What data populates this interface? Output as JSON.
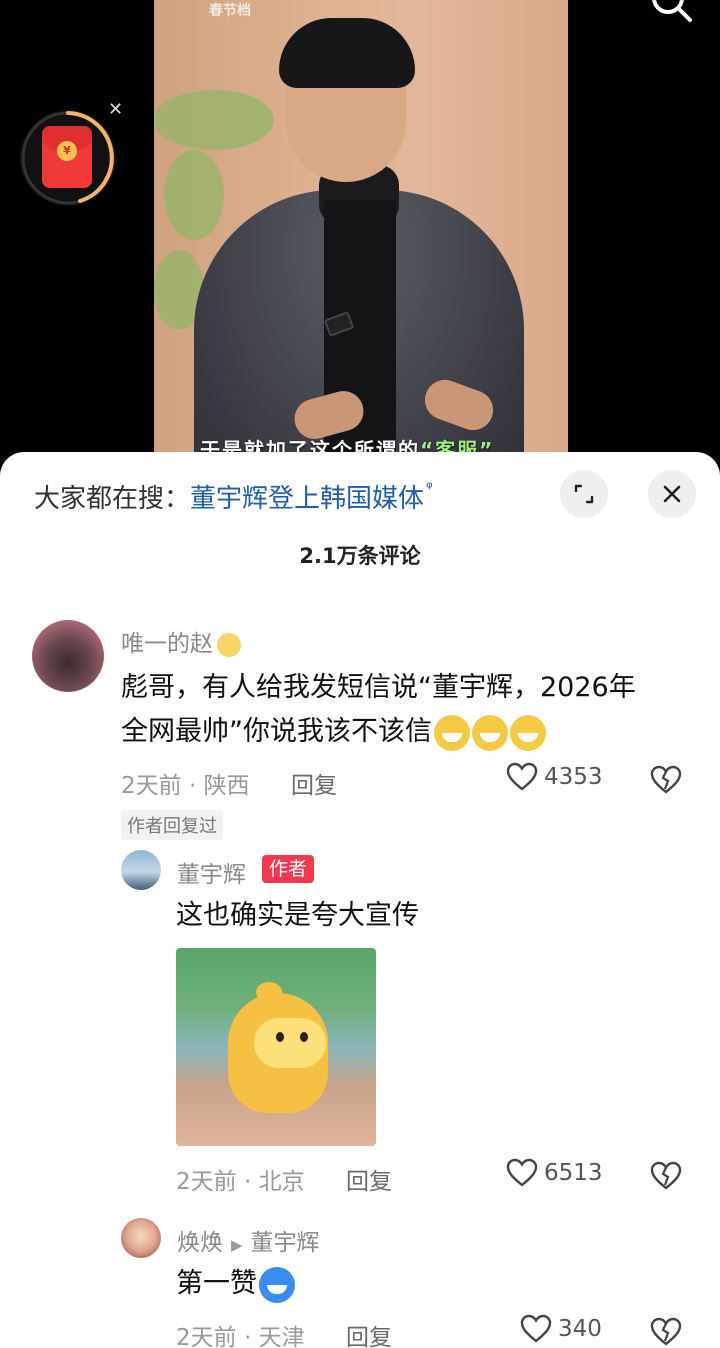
{
  "video": {
    "top_label": "春节档",
    "subtitle_prefix": "于是就加了这个所谓的",
    "subtitle_highlight": "“客服”"
  },
  "search": {
    "prefix": "大家都在搜：",
    "query": "董宇辉登上韩国媒体"
  },
  "comments_header": {
    "count_label": "2.1万条评论"
  },
  "comments": [
    {
      "user": "唯一的赵",
      "text_line1": "彪哥，有人给我发短信说“董宇辉，2026年",
      "text_line2": "全网最帅”你说我该不该信",
      "time_location": "2天前 · 陕西",
      "reply_label": "回复",
      "likes": "4353",
      "author_replied_tag": "作者回复过"
    }
  ],
  "replies": [
    {
      "user": "董宇辉",
      "badge": "作者",
      "text": "这也确实是夸大宣传",
      "time_location": "2天前 · 北京",
      "reply_label": "回复",
      "likes": "6513"
    },
    {
      "user": "焕焕",
      "reply_to": "董宇辉",
      "text": "第一赞",
      "time_location": "2天前 · 天津",
      "reply_label": "回复",
      "likes": "340"
    }
  ],
  "colors": {
    "accent_link": "#1f5ea8",
    "author_badge": "#f0394f"
  }
}
